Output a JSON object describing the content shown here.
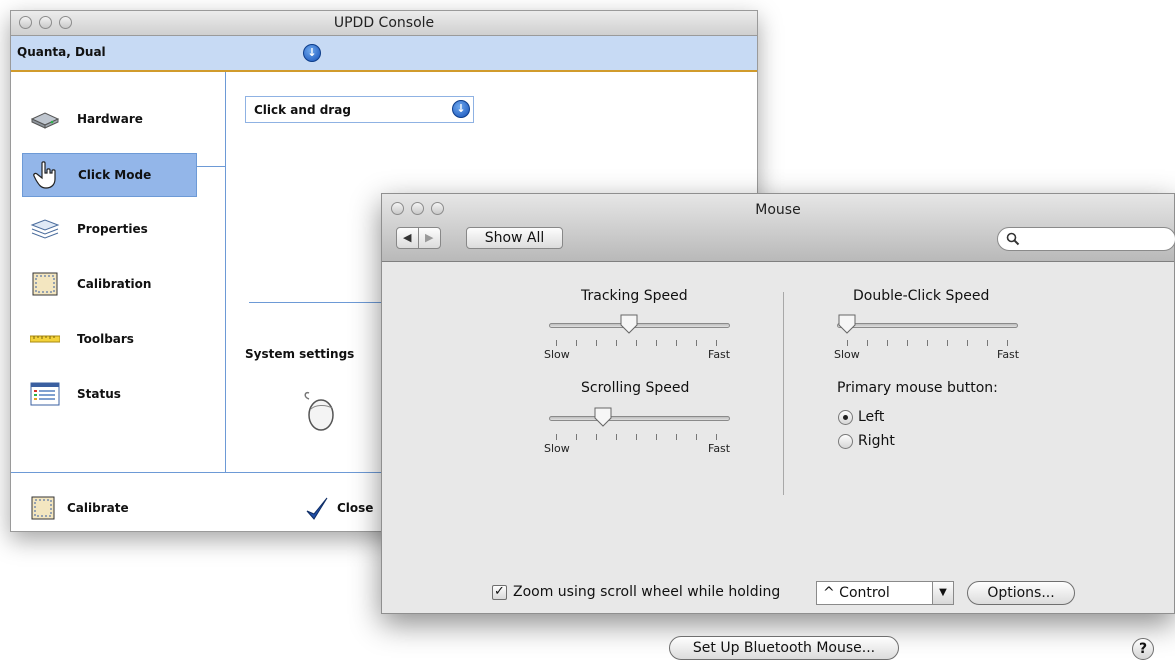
{
  "updd": {
    "title": "UPDD Console",
    "device": "Quanta, Dual",
    "sidebar": [
      {
        "label": "Hardware",
        "icon": "hardware-icon"
      },
      {
        "label": "Click Mode",
        "icon": "hand-pointer-icon",
        "selected": true
      },
      {
        "label": "Properties",
        "icon": "layers-icon"
      },
      {
        "label": "Calibration",
        "icon": "calibration-icon"
      },
      {
        "label": "Toolbars",
        "icon": "ruler-icon"
      },
      {
        "label": "Status",
        "icon": "status-list-icon"
      }
    ],
    "click_mode": "Click and drag",
    "system_settings": "System settings",
    "footer": {
      "calibrate": "Calibrate",
      "close": "Close"
    }
  },
  "mouse": {
    "title": "Mouse",
    "show_all": "Show All",
    "search_placeholder": "",
    "tracking": {
      "label": "Tracking Speed",
      "slow": "Slow",
      "fast": "Fast",
      "level": 0.45
    },
    "scrolling": {
      "label": "Scrolling Speed",
      "slow": "Slow",
      "fast": "Fast",
      "level": 0.3
    },
    "double_click": {
      "label": "Double-Click Speed",
      "slow": "Slow",
      "fast": "Fast",
      "level": 0.0
    },
    "primary_button": {
      "label": "Primary mouse button:",
      "left": "Left",
      "right": "Right",
      "selected": "Left"
    },
    "zoom": {
      "label": "Zoom using scroll wheel while holding",
      "checked": true,
      "modifier": "^ Control",
      "options": "Options..."
    },
    "bluetooth": "Set Up Bluetooth Mouse...",
    "help": "?"
  }
}
